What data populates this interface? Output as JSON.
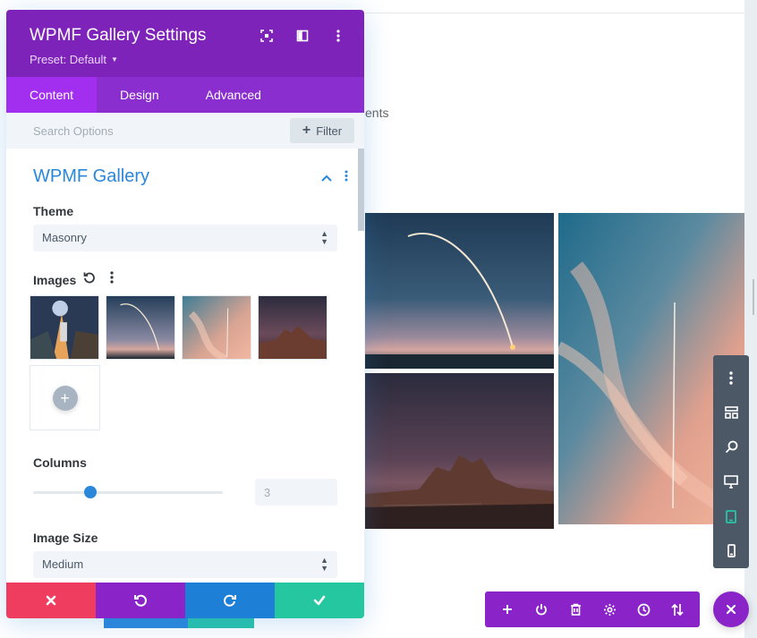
{
  "modal": {
    "title": "WPMF Gallery Settings",
    "preset": "Preset: Default",
    "header_icons": [
      "fullscreen-icon",
      "split-view-icon",
      "more-vertical-icon"
    ]
  },
  "tabs": [
    {
      "label": "Content",
      "active": true
    },
    {
      "label": "Design",
      "active": false
    },
    {
      "label": "Advanced",
      "active": false
    }
  ],
  "search": {
    "placeholder": "Search Options",
    "filter_label": "Filter"
  },
  "section": {
    "title": "WPMF Gallery",
    "expanded": true
  },
  "fields": {
    "theme": {
      "label": "Theme",
      "value": "Masonry"
    },
    "images": {
      "label": "Images"
    },
    "columns": {
      "label": "Columns",
      "value": "3",
      "slider_fraction": 0.3
    },
    "image_size": {
      "label": "Image Size",
      "value": "Medium"
    }
  },
  "background": {
    "partial_text": "ents"
  },
  "colors": {
    "header": "#7e23b9",
    "tab_active": "#a22ff0",
    "accent_blue": "#2b87da",
    "discard": "#ef3d5f",
    "save": "#24c79f"
  }
}
